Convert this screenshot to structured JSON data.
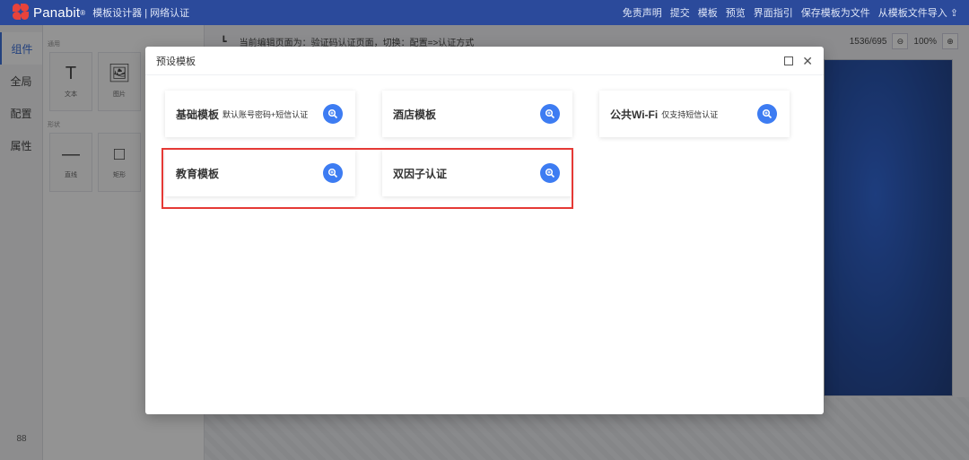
{
  "topbar": {
    "brand": "Panabit",
    "brand_reg": "®",
    "app_title": "模板设计器 | 网络认证",
    "actions": [
      "免责声明",
      "提交",
      "模板",
      "预览",
      "界面指引",
      "保存模板为文件",
      "从模板文件导入"
    ]
  },
  "leftnav": {
    "items": [
      "组件",
      "全局",
      "配置",
      "属性"
    ],
    "bottom_icon": "88"
  },
  "components": {
    "section_common": "通用",
    "section_shape": "形状",
    "tiles": [
      "文本",
      "图片",
      "直线",
      "矩形"
    ]
  },
  "canvas": {
    "hint": "当前编辑页面为：验证码认证页面，切换：配置=>认证方式",
    "size": "1536/695",
    "zoom": "100%"
  },
  "modal": {
    "title": "预设模板",
    "cards": [
      {
        "name": "基础模板",
        "sub": "默认账号密码+短信认证"
      },
      {
        "name": "酒店模板",
        "sub": ""
      },
      {
        "name": "公共Wi-Fi",
        "sub": "仅支持短信认证"
      },
      {
        "name": "教育模板",
        "sub": ""
      },
      {
        "name": "双因子认证",
        "sub": ""
      }
    ]
  },
  "colors": {
    "topbar": "#2b4a9b",
    "accent": "#3d7cf2",
    "highlight": "#e53935"
  }
}
